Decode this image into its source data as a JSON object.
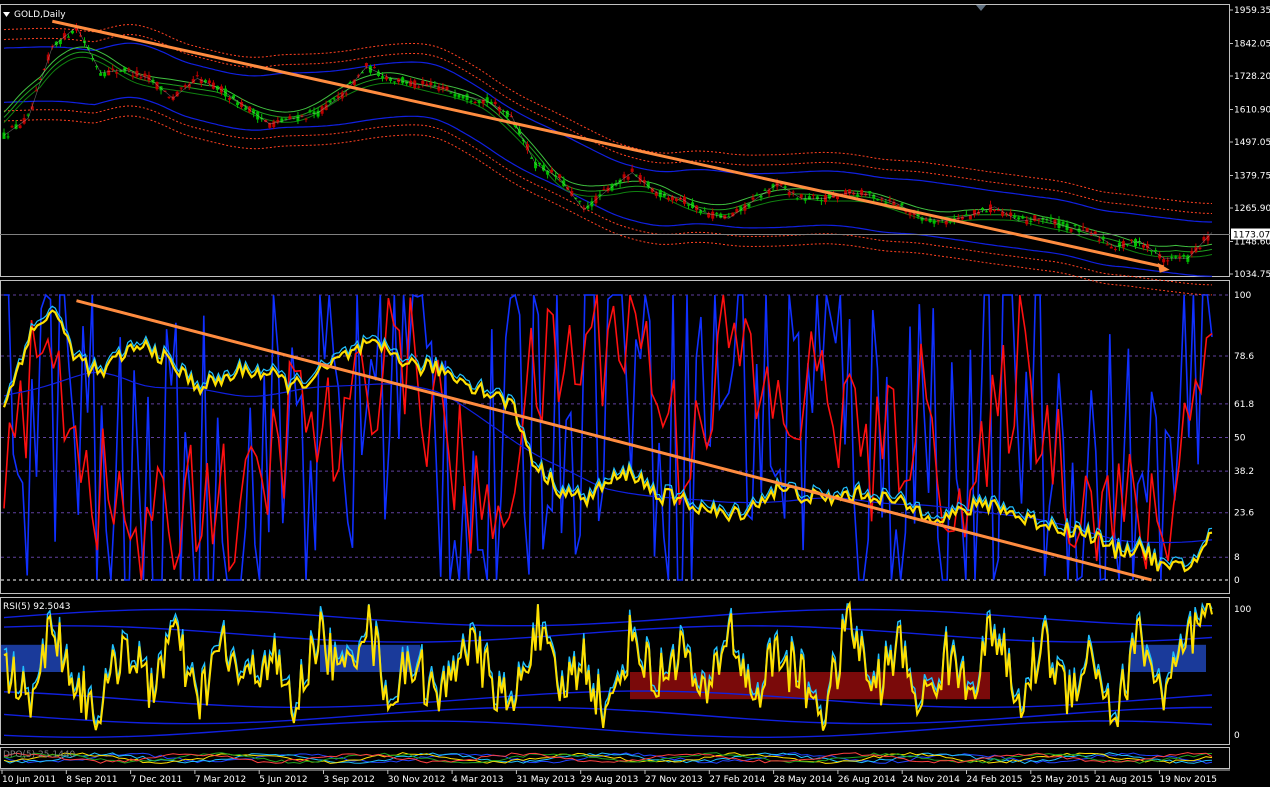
{
  "window": {
    "symbol_label": "GOLD,Daily",
    "rsi_label": "RSI(5) 92.5043",
    "bottom_label": "DPO(5) 25.1440"
  },
  "colors": {
    "background": "#000000",
    "frame": "#c0c0c0",
    "price_line": "#c0c0c0",
    "bull_candle": "#00c000",
    "bear_candle": "#c00000",
    "trendline": "#ff8c40",
    "envelope_dotted": "#ff4020",
    "band_blue": "#1020e0",
    "ma_green": "#20a020",
    "stoch_red": "#ff1010",
    "stoch_blue": "#1030ff",
    "smooth_yellow": "#ffe000",
    "smooth_cyan": "#20c0ff",
    "level_dash": "#6040a0",
    "rsi_block_blue": "#1a3a9a",
    "rsi_block_red": "#7a0a0a"
  },
  "x_axis": {
    "labels": [
      "10 Jun 2011",
      "8 Sep 2011",
      "7 Dec 2011",
      "7 Mar 2012",
      "5 Jun 2012",
      "3 Sep 2012",
      "30 Nov 2012",
      "4 Mar 2013",
      "31 May 2013",
      "29 Aug 2013",
      "27 Nov 2013",
      "27 Feb 2014",
      "28 May 2014",
      "26 Aug 2014",
      "24 Nov 2014",
      "24 Feb 2015",
      "25 May 2015",
      "21 Aug 2015",
      "19 Nov 2015"
    ]
  },
  "chart_data": [
    {
      "type": "line",
      "title": "GOLD,Daily",
      "ylim": [
        1034.75,
        1959.35
      ],
      "y_ticks": [
        1959.35,
        1842.05,
        1728.2,
        1610.9,
        1497.05,
        1379.75,
        1265.9,
        1148.6,
        1034.75
      ],
      "current_price": 1173.07,
      "current_price_label": "1173.07",
      "series": [
        {
          "name": "",
          "x": [
            0,
            2,
            4,
            6,
            8,
            10,
            12,
            14,
            16,
            18,
            20,
            22,
            24,
            26,
            28,
            30,
            32,
            34,
            36,
            38,
            40,
            42,
            44,
            46,
            48,
            50,
            52,
            54,
            56,
            58,
            60,
            62,
            64,
            66,
            68,
            70,
            72,
            74,
            76,
            78,
            80,
            82,
            84,
            86,
            88,
            90,
            92,
            94,
            96,
            98,
            100
          ],
          "values": [
            1520,
            1580,
            1830,
            1900,
            1740,
            1750,
            1720,
            1650,
            1720,
            1680,
            1620,
            1560,
            1580,
            1600,
            1660,
            1760,
            1720,
            1700,
            1690,
            1660,
            1640,
            1590,
            1420,
            1370,
            1260,
            1330,
            1390,
            1320,
            1300,
            1250,
            1230,
            1290,
            1350,
            1300,
            1300,
            1320,
            1310,
            1280,
            1230,
            1220,
            1240,
            1270,
            1220,
            1230,
            1200,
            1180,
            1130,
            1150,
            1090,
            1090,
            1180
          ]
        }
      ],
      "trendline": {
        "start": [
          4,
          1920
        ],
        "end": [
          96,
          1060
        ]
      }
    },
    {
      "type": "line",
      "title": "",
      "ylim": [
        0,
        100
      ],
      "y_ticks": [
        100,
        78.6,
        61.8,
        50,
        38.2,
        23.6,
        8,
        0
      ],
      "series": [
        {
          "name": "",
          "x": [
            0,
            2,
            4,
            6,
            8,
            10,
            12,
            14,
            16,
            18,
            20,
            22,
            24,
            26,
            28,
            30,
            32,
            34,
            36,
            38,
            40,
            42,
            44,
            46,
            48,
            50,
            52,
            54,
            56,
            58,
            60,
            62,
            64,
            66,
            68,
            70,
            72,
            74,
            76,
            78,
            80,
            82,
            84,
            86,
            88,
            90,
            92,
            94,
            96,
            98,
            100
          ],
          "values": [
            60,
            85,
            95,
            78,
            72,
            80,
            82,
            75,
            68,
            70,
            74,
            72,
            68,
            72,
            78,
            82,
            80,
            75,
            74,
            70,
            66,
            62,
            40,
            32,
            28,
            34,
            38,
            30,
            28,
            25,
            22,
            26,
            32,
            30,
            28,
            30,
            30,
            27,
            24,
            22,
            25,
            27,
            22,
            20,
            18,
            16,
            10,
            12,
            4,
            4,
            16
          ]
        },
        {
          "name": "",
          "x": [
            0,
            4,
            8,
            12,
            16,
            20,
            24,
            28,
            32,
            36,
            40,
            44,
            48,
            52,
            56,
            60,
            64,
            68,
            72,
            76,
            80,
            84,
            88,
            92,
            96,
            100
          ],
          "values": [
            50,
            80,
            30,
            10,
            35,
            20,
            60,
            45,
            90,
            55,
            15,
            70,
            80,
            95,
            45,
            85,
            55,
            70,
            40,
            60,
            20,
            80,
            35,
            25,
            15,
            100
          ]
        }
      ],
      "trendline": {
        "start": [
          6,
          98
        ],
        "end": [
          95,
          0
        ]
      }
    },
    {
      "type": "line",
      "title": "RSI(5) 92.5043",
      "ylim": [
        0,
        100
      ],
      "y_ticks": [
        100,
        0
      ],
      "series": [
        {
          "name": "RSI(5)",
          "x": [
            0,
            2,
            4,
            6,
            8,
            10,
            12,
            14,
            16,
            18,
            20,
            22,
            24,
            26,
            28,
            30,
            32,
            34,
            36,
            38,
            40,
            42,
            44,
            46,
            48,
            50,
            52,
            54,
            56,
            58,
            60,
            62,
            64,
            66,
            68,
            70,
            72,
            74,
            76,
            78,
            80,
            82,
            84,
            86,
            88,
            90,
            92,
            94,
            96,
            98,
            100
          ],
          "values": [
            55,
            30,
            85,
            40,
            20,
            75,
            35,
            80,
            25,
            70,
            40,
            65,
            20,
            80,
            45,
            90,
            30,
            60,
            25,
            75,
            50,
            20,
            85,
            35,
            60,
            15,
            80,
            40,
            70,
            25,
            85,
            30,
            65,
            45,
            20,
            90,
            35,
            70,
            25,
            60,
            40,
            85,
            20,
            75,
            35,
            65,
            15,
            80,
            30,
            70,
            92.5
          ]
        }
      ]
    }
  ]
}
